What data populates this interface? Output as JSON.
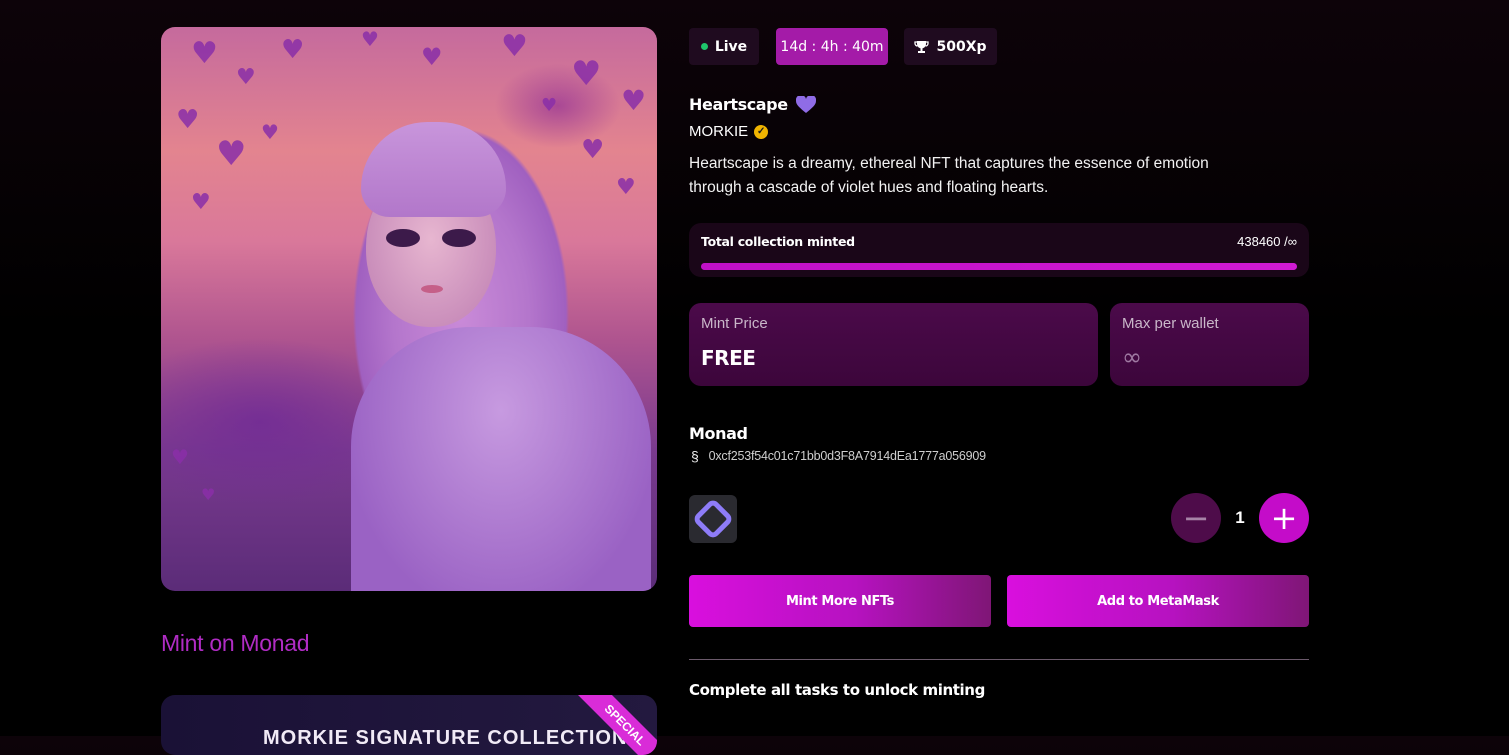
{
  "badges": {
    "status": "Live",
    "timer": "14d : 4h : 40m",
    "xp": "500Xp"
  },
  "nft": {
    "title": "Heartscape",
    "creator": "MORKIE",
    "description": "Heartscape is a dreamy, ethereal NFT that captures the essence of emotion through a cascade of violet hues and floating hearts."
  },
  "progress": {
    "label": "Total collection minted",
    "count": "438460 /∞",
    "fraction": 1.0
  },
  "stats": {
    "price_label": "Mint Price",
    "price_value": "FREE",
    "max_label": "Max per wallet",
    "max_value": "∞"
  },
  "chain": {
    "name": "Monad",
    "address": "0xcf253f54c01c71bb0d3F8A7914dEa1777a056909"
  },
  "quantity": {
    "value": "1"
  },
  "actions": {
    "mint": "Mint More NFTs",
    "metamask": "Add to MetaMask"
  },
  "tasks": {
    "heading": "Complete all tasks to unlock minting"
  },
  "left": {
    "mint_on": "Mint on Monad",
    "collection_title": "MORKIE SIGNATURE COLLECTION",
    "ribbon": "SPECIAL"
  },
  "colors": {
    "accent": "#d90fde",
    "live": "#1ec66b",
    "verified": "#f0b400"
  },
  "icons": {
    "trophy": "trophy-icon",
    "heart": "purple-heart-icon",
    "verified": "verified-badge-icon",
    "chain": "monad-glyph-icon",
    "wallet": "wallet-logo-icon"
  }
}
